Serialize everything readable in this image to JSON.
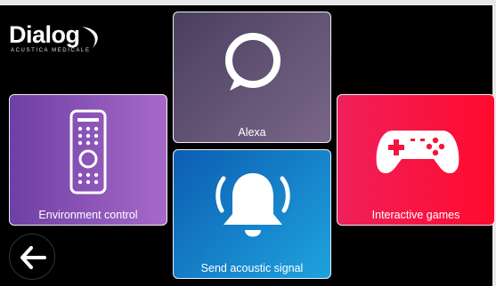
{
  "brand": {
    "name": "Dialog",
    "tagline": "ACUSTICA MEDICALE"
  },
  "tiles": [
    {
      "id": "alexa",
      "label": "Alexa",
      "icon": "alexa-ring-icon",
      "color": "#5b4d6e"
    },
    {
      "id": "environment",
      "label": "Environment control",
      "icon": "remote-control-icon",
      "color": "#8a52b8"
    },
    {
      "id": "acoustic",
      "label": "Send acoustic signal",
      "icon": "bell-icon",
      "color": "#1784cc"
    },
    {
      "id": "games",
      "label": "Interactive games",
      "icon": "gamepad-icon",
      "color": "#f81445"
    }
  ],
  "nav": {
    "back_icon": "arrow-left-icon"
  }
}
